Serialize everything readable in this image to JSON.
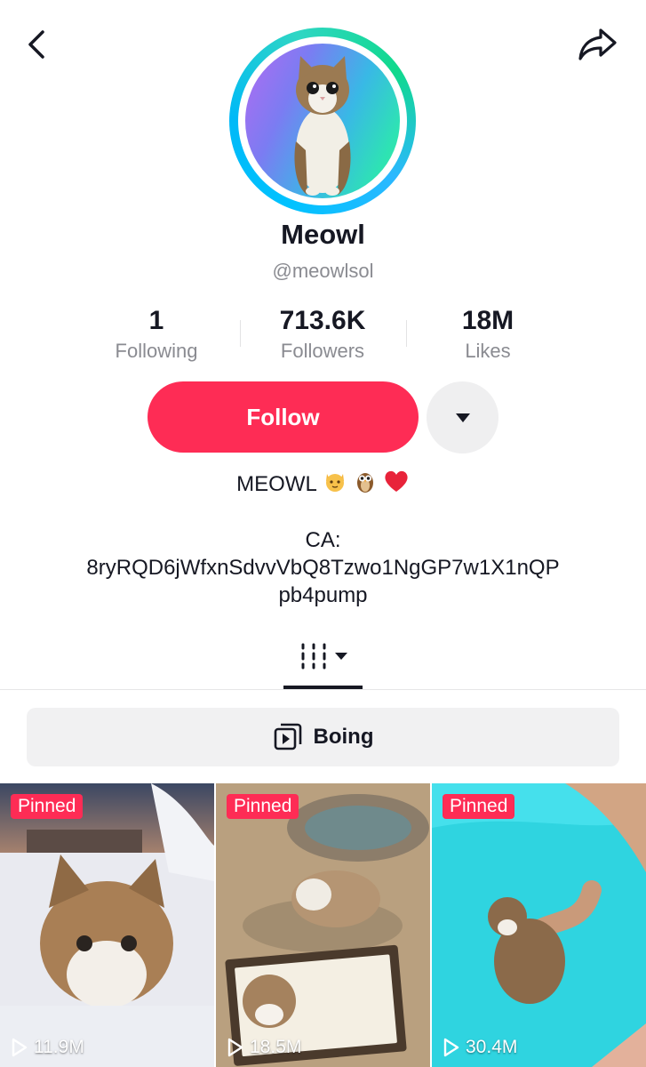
{
  "profile": {
    "display_name": "Meowl",
    "handle": "@meowlsol"
  },
  "stats": [
    {
      "value": "1",
      "label": "Following"
    },
    {
      "value": "713.6K",
      "label": "Followers"
    },
    {
      "value": "18M",
      "label": "Likes"
    }
  ],
  "actions": {
    "follow_label": "Follow"
  },
  "bio": {
    "line1": "MEOWL",
    "line1_emojis": [
      "cat-face-icon",
      "owl-icon",
      "red-heart-icon"
    ],
    "ca_label": "CA:",
    "ca_line1": "8ryRQD6jWfxnSdvvVbQ8Tzwo1NgGP7w1X1nQP",
    "ca_line2": "pb4pump"
  },
  "playlist": {
    "label": "Boing"
  },
  "videos": [
    {
      "badge": "Pinned",
      "views": "11.9M"
    },
    {
      "badge": "Pinned",
      "views": "18.5M"
    },
    {
      "badge": "Pinned",
      "views": "30.4M"
    }
  ],
  "colors": {
    "accent": "#fe2c55",
    "text": "#161823",
    "secondary_text": "#8a8b91"
  }
}
